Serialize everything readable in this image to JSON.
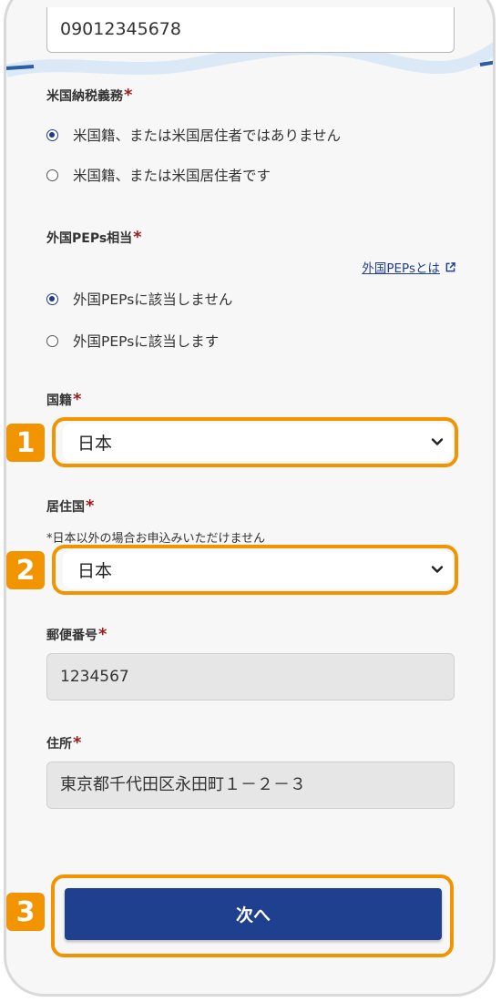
{
  "phone_field": {
    "value": "09012345678"
  },
  "us_tax": {
    "label": "米国納税義務",
    "required_mark": "*",
    "options": [
      {
        "label": "米国籍、または米国居住者ではありません",
        "checked": true
      },
      {
        "label": "米国籍、または米国居住者です",
        "checked": false
      }
    ]
  },
  "peps": {
    "label": "外国PEPs相当",
    "required_mark": "*",
    "help_link": "外国PEPsとは",
    "options": [
      {
        "label": "外国PEPsに該当しません",
        "checked": true
      },
      {
        "label": "外国PEPsに該当します",
        "checked": false
      }
    ]
  },
  "nationality": {
    "label": "国籍",
    "required_mark": "*",
    "selected": "日本",
    "step": "1"
  },
  "residence": {
    "label": "居住国",
    "required_mark": "*",
    "note": "*日本以外の場合お申込みいただけません",
    "selected": "日本",
    "step": "2"
  },
  "postal": {
    "label": "郵便番号",
    "required_mark": "*",
    "value": "1234567"
  },
  "address": {
    "label": "住所",
    "required_mark": "*",
    "value": "東京都千代田区永田町１－２－３"
  },
  "next_button": {
    "label": "次へ",
    "step": "3"
  },
  "colors": {
    "accent_orange": "#f29400",
    "primary_blue": "#1f3f8f",
    "required_red": "#9b1c1c"
  }
}
